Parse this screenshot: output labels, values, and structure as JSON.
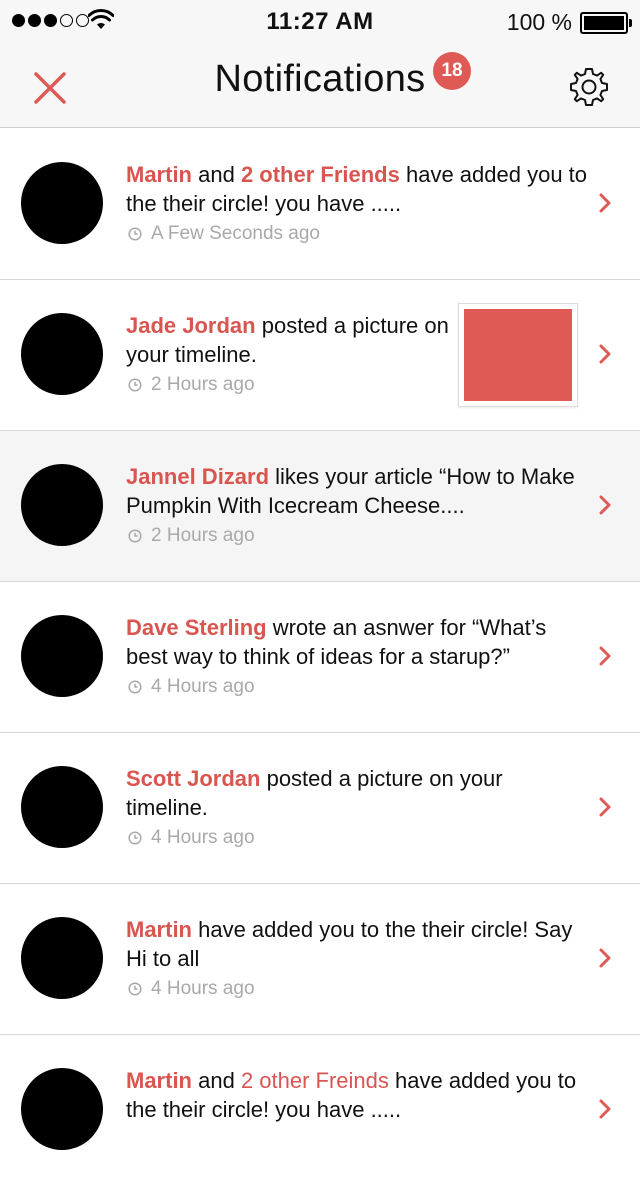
{
  "status_bar": {
    "time": "11:27 AM",
    "battery": "100 %",
    "signal_bars": 3,
    "signal_total": 5
  },
  "nav": {
    "title": "Notifications",
    "badge_count": "18",
    "close_icon": "close-icon",
    "settings_icon": "gear-icon"
  },
  "colors": {
    "accent": "#e05a55",
    "time_text": "#a9a9a9"
  },
  "notifications": [
    {
      "name": "Martin",
      "line_part1": " and ",
      "friends": "2 other Friends",
      "line_part2": " have added you  to the their circle! you have .....",
      "time": "A Few Seconds ago"
    },
    {
      "name": "Jade Jordan",
      "text": " posted a picture on your timeline.",
      "time": "2 Hours ago",
      "has_picture": true
    },
    {
      "name": "Jannel Dizard",
      "text": " likes your article “How to Make Pumpkin With Icecream Cheese....",
      "time": "2 Hours ago",
      "highlighted": true
    },
    {
      "name": "Dave Sterling",
      "text": " wrote an asnwer for “What’s best way to think of ideas for a starup?”",
      "time": "4 Hours ago"
    },
    {
      "name": "Scott Jordan",
      "text": " posted a picture on your timeline.",
      "time": "4 Hours ago"
    },
    {
      "name": "Martin",
      "text": " have added you  to the their circle! Say Hi to all",
      "time": "4 Hours ago"
    },
    {
      "name": "Martin",
      "line_part1": " and ",
      "friends": "2 other Freinds",
      "line_part2": " have added you  to the their circle! you have .....",
      "time": ""
    }
  ]
}
